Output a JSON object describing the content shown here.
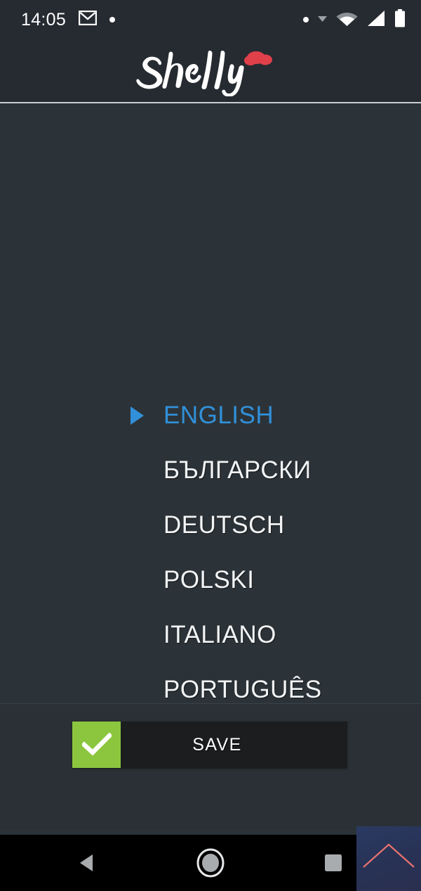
{
  "statusbar": {
    "time": "14:05",
    "icons": [
      "gmail-icon",
      "notification-dot",
      "status-dot",
      "dropdown-caret-icon",
      "wifi-icon",
      "cellular-signal-icon",
      "battery-icon"
    ]
  },
  "header": {
    "brand": "Shelly",
    "logo_color": "#ffffff",
    "cloud_color": "#e0404a",
    "background": "#262b31"
  },
  "main": {
    "background": "#2c3338",
    "selected_color": "#3190d9",
    "text_color": "#f2f4f5",
    "languages": [
      {
        "label": "ENGLISH",
        "selected": true
      },
      {
        "label": "БЪЛГАРСКИ",
        "selected": false
      },
      {
        "label": "DEUTSCH",
        "selected": false
      },
      {
        "label": "POLSKI",
        "selected": false
      },
      {
        "label": "ITALIANO",
        "selected": false
      },
      {
        "label": "PORTUGUÊS",
        "selected": false
      }
    ]
  },
  "footer": {
    "save_label": "SAVE",
    "check_color": "#8cc63e",
    "bar_color": "#1b1d1f"
  },
  "navbar": {
    "back_label": "back-button",
    "home_label": "home-button",
    "recents_label": "recents-button"
  },
  "overlay": {
    "chevron_color": "#e8726f"
  }
}
